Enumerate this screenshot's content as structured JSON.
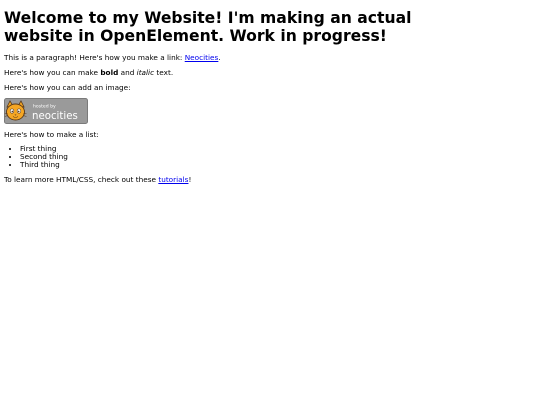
{
  "page": {
    "heading": "Welcome to my Website! I'm making an actual website in OpenElement. Work in progress!",
    "paragraph_link": {
      "prefix": "This is a paragraph! Here's how you make a link: ",
      "link_text": "Neocities",
      "suffix": "."
    },
    "bold_italic": {
      "prefix": "Here's how you can make ",
      "bold_text": "bold",
      "middle": " and ",
      "italic_text": "italic",
      "suffix": " text."
    },
    "image_intro": "Here's how you can add an image:",
    "badge": {
      "small_text": "hosted by",
      "big_text": "neocities",
      "icon": "neocities-cat-icon",
      "colors": {
        "background": "#9a9a9a",
        "cat": "#f5a623",
        "outline": "#5a3a1a",
        "text": "#ffffff"
      }
    },
    "list_intro": "Here's how to make a list:",
    "list_items": [
      "First thing",
      "Second thing",
      "Third thing"
    ],
    "tutorials": {
      "prefix": "To learn more HTML/CSS, check out these ",
      "link_text": "tutorials",
      "suffix": "!"
    }
  }
}
